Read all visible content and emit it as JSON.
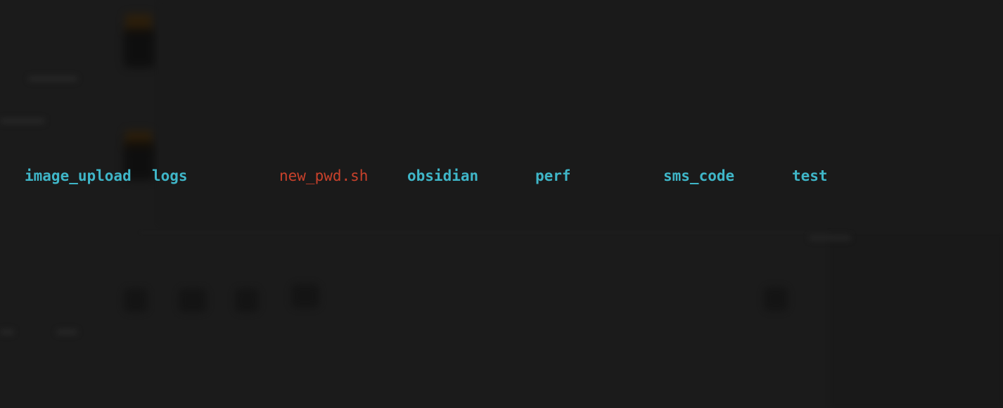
{
  "terminal": {
    "listing": [
      {
        "name": "image_upload",
        "kind": "directory"
      },
      {
        "name": "logs",
        "kind": "directory"
      },
      {
        "name": "new_pwd.sh",
        "kind": "executable"
      },
      {
        "name": "obsidian",
        "kind": "directory"
      },
      {
        "name": "perf",
        "kind": "directory"
      },
      {
        "name": "sms_code",
        "kind": "directory"
      },
      {
        "name": "test",
        "kind": "directory"
      }
    ],
    "colors": {
      "background": "#1b1b1b",
      "directory": "#3fb6c8",
      "executable": "#c8412b"
    }
  }
}
